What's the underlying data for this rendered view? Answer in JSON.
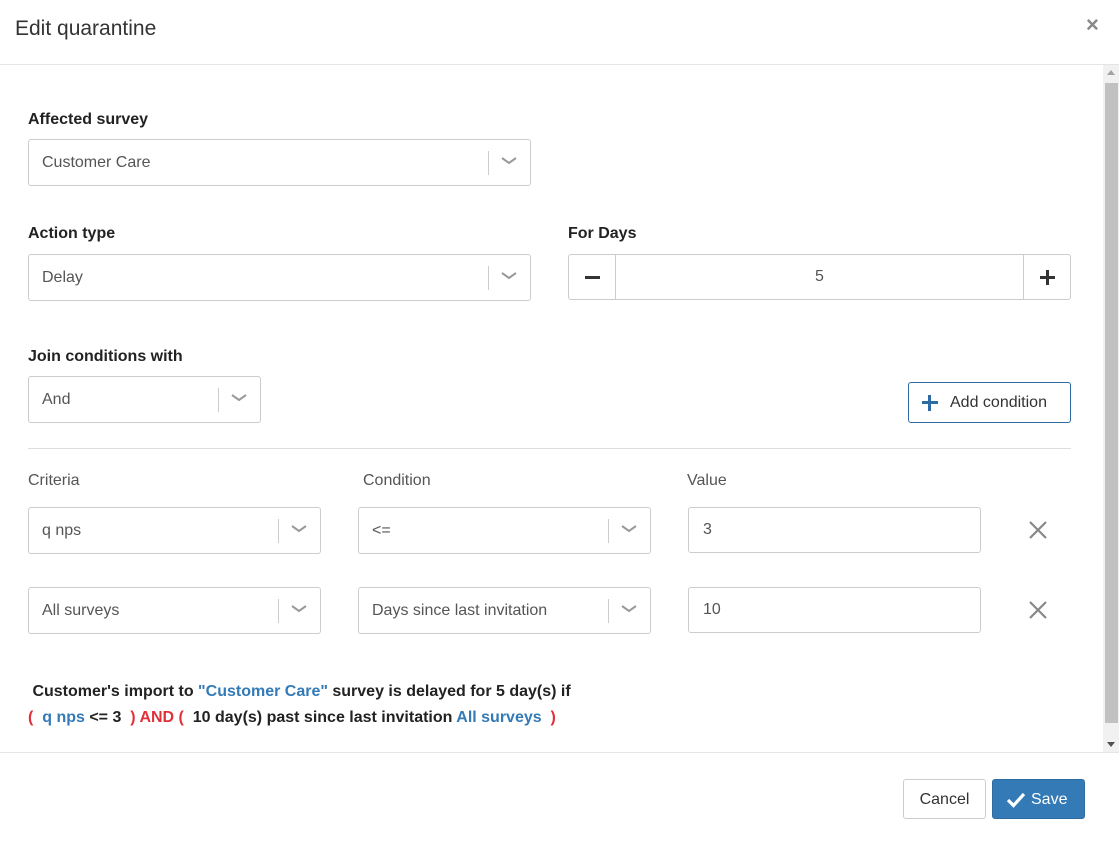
{
  "dialog": {
    "title": "Edit quarantine",
    "close_symbol": "×"
  },
  "affected_survey": {
    "label": "Affected survey",
    "value": "Customer Care"
  },
  "action_type": {
    "label": "Action type",
    "value": "Delay"
  },
  "for_days": {
    "label": "For Days",
    "value": "5"
  },
  "join": {
    "label": "Join conditions with",
    "value": "And"
  },
  "add_condition_label": "Add condition",
  "columns": {
    "criteria": "Criteria",
    "condition": "Condition",
    "value": "Value"
  },
  "rows": [
    {
      "criteria": "q nps",
      "condition": "<=",
      "value": "3"
    },
    {
      "criteria": "All surveys",
      "condition": "Days since last invitation",
      "value": "10"
    }
  ],
  "summary": {
    "line1_a": " Customer's import to ",
    "line1_survey": "\"Customer Care\"",
    "line1_b": " survey is delayed for 5 day(s) if",
    "l2_open": "(  ",
    "l2_crit": "q nps",
    "l2_cond": " <= 3 ",
    "l2_and": " ) AND (  ",
    "l2_text": "10 day(s) past since last invitation ",
    "l2_surveys": "All surveys",
    "l2_close": "  )"
  },
  "footer": {
    "cancel_label": "Cancel",
    "save_label": "Save"
  },
  "colors": {
    "primary": "#337ab7",
    "accent_red": "#e0313b",
    "border": "#cccccc"
  }
}
